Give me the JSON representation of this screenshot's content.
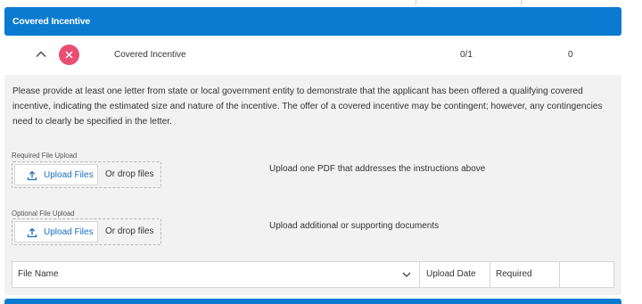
{
  "section": {
    "header_title": "Covered Incentive",
    "header_color": "#0b7ad1"
  },
  "row": {
    "name": "Covered Incentive",
    "count": "0/1",
    "zero": "0",
    "expand_icon": "chevron-up-icon",
    "remove_icon": "close-circle-icon",
    "remove_color": "#ea4e73"
  },
  "panel": {
    "instructions": "Please provide at least one letter from state or local government entity to demonstrate that the applicant has been offered a qualifying covered incentive, indicating the estimated size and nature of the incentive. The offer of a covered incentive may be contingent; however, any contingencies need to clearly be specified in the letter.",
    "required_upload": {
      "label": "Required File Upload",
      "button_label": "Upload Files",
      "drop_text": "Or drop files",
      "help": "Upload one PDF that addresses the instructions above"
    },
    "optional_upload": {
      "label": "Optional File Upload",
      "button_label": "Upload Files",
      "drop_text": "Or drop files",
      "help": "Upload additional or supporting documents"
    },
    "table": {
      "columns": [
        "File Name",
        "Upload Date",
        "Required",
        ""
      ],
      "sort_icon": "chevron-down-icon"
    }
  },
  "link_color": "#1a6fbf"
}
